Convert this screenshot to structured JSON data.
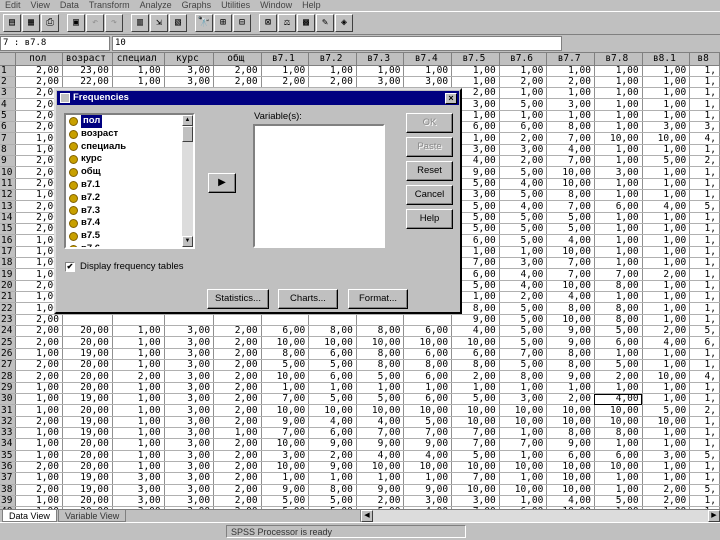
{
  "menu": [
    "Edit",
    "View",
    "Data",
    "Transform",
    "Analyze",
    "Graphs",
    "Utilities",
    "Window",
    "Help"
  ],
  "toolbar": {
    "icons": [
      {
        "name": "open-icon",
        "glyph": "▤"
      },
      {
        "name": "save-icon",
        "glyph": "▦"
      },
      {
        "name": "print-icon",
        "glyph": "⎙"
      },
      {
        "name": "dialog-recall-icon",
        "glyph": "▣"
      },
      {
        "name": "undo-icon",
        "glyph": "↶"
      },
      {
        "name": "redo-icon",
        "glyph": "↷"
      },
      {
        "name": "goto-chart-icon",
        "glyph": "▥"
      },
      {
        "name": "goto-case-icon",
        "glyph": "⇲"
      },
      {
        "name": "variables-icon",
        "glyph": "▧"
      },
      {
        "name": "find-icon",
        "glyph": "🔭"
      },
      {
        "name": "insert-case-icon",
        "glyph": "⊞"
      },
      {
        "name": "insert-variable-icon",
        "glyph": "⊟"
      },
      {
        "name": "split-file-icon",
        "glyph": "⊠"
      },
      {
        "name": "weight-cases-icon",
        "glyph": "⚖"
      },
      {
        "name": "select-cases-icon",
        "glyph": "▩"
      },
      {
        "name": "value-labels-icon",
        "glyph": "✎"
      },
      {
        "name": "use-sets-icon",
        "glyph": "◈"
      }
    ]
  },
  "cellbar": {
    "ref": "7 : в7.8",
    "value": "10"
  },
  "grid": {
    "columns": [
      "пол",
      "возраст",
      "специал",
      "курс",
      "общ",
      "в7.1",
      "в7.2",
      "в7.3",
      "в7.4",
      "в7.5",
      "в7.6",
      "в7.7",
      "в7.8",
      "в8.1",
      "в8"
    ],
    "rows": [
      {
        "n": "1",
        "cells": [
          "2,00",
          "23,00",
          "1,00",
          "3,00",
          "2,00",
          "1,00",
          "1,00",
          "1,00",
          "1,00",
          "1,00",
          "1,00",
          "1,00",
          "1,00",
          "1,00",
          "1,"
        ]
      },
      {
        "n": "2",
        "cells": [
          "2,00",
          "22,00",
          "1,00",
          "3,00",
          "2,00",
          "2,00",
          "2,00",
          "3,00",
          "3,00",
          "1,00",
          "2,00",
          "2,00",
          "1,00",
          "1,00",
          "1,"
        ]
      },
      {
        "n": "3",
        "cells": [
          "2,00",
          "",
          "",
          "",
          "",
          "",
          "",
          "",
          "",
          "2,00",
          "1,00",
          "1,00",
          "1,00",
          "1,00",
          "1,"
        ]
      },
      {
        "n": "4",
        "cells": [
          "2,00",
          "",
          "",
          "",
          "",
          "",
          "",
          "",
          "",
          "3,00",
          "5,00",
          "3,00",
          "1,00",
          "1,00",
          "1,"
        ]
      },
      {
        "n": "5",
        "cells": [
          "2,00",
          "",
          "",
          "",
          "",
          "",
          "",
          "",
          "",
          "1,00",
          "1,00",
          "1,00",
          "1,00",
          "1,00",
          "1,"
        ]
      },
      {
        "n": "6",
        "cells": [
          "2,00",
          "",
          "",
          "",
          "",
          "",
          "",
          "",
          "",
          "6,00",
          "6,00",
          "8,00",
          "1,00",
          "3,00",
          "3,"
        ]
      },
      {
        "n": "7",
        "cells": [
          "1,00",
          "",
          "",
          "",
          "",
          "",
          "",
          "",
          "",
          "1,00",
          "2,00",
          "7,00",
          "10,00",
          "10,00",
          "4,"
        ]
      },
      {
        "n": "8",
        "cells": [
          "1,00",
          "",
          "",
          "",
          "",
          "",
          "",
          "",
          "",
          "3,00",
          "3,00",
          "4,00",
          "1,00",
          "1,00",
          "1,"
        ]
      },
      {
        "n": "9",
        "cells": [
          "2,00",
          "",
          "",
          "",
          "",
          "",
          "",
          "",
          "",
          "4,00",
          "2,00",
          "7,00",
          "1,00",
          "5,00",
          "2,"
        ]
      },
      {
        "n": "10",
        "cells": [
          "2,00",
          "",
          "",
          "",
          "",
          "",
          "",
          "",
          "",
          "9,00",
          "5,00",
          "10,00",
          "3,00",
          "1,00",
          "1,"
        ]
      },
      {
        "n": "11",
        "cells": [
          "2,00",
          "",
          "",
          "",
          "",
          "",
          "",
          "",
          "",
          "5,00",
          "4,00",
          "10,00",
          "1,00",
          "1,00",
          "1,"
        ]
      },
      {
        "n": "12",
        "cells": [
          "1,00",
          "",
          "",
          "",
          "",
          "",
          "",
          "",
          "",
          "3,00",
          "5,00",
          "8,00",
          "1,00",
          "1,00",
          "1,"
        ]
      },
      {
        "n": "13",
        "cells": [
          "2,00",
          "",
          "",
          "",
          "",
          "",
          "",
          "",
          "",
          "5,00",
          "4,00",
          "7,00",
          "6,00",
          "4,00",
          "5,"
        ]
      },
      {
        "n": "14",
        "cells": [
          "2,00",
          "",
          "",
          "",
          "",
          "",
          "",
          "",
          "",
          "5,00",
          "5,00",
          "5,00",
          "1,00",
          "1,00",
          "1,"
        ]
      },
      {
        "n": "15",
        "cells": [
          "2,00",
          "",
          "",
          "",
          "",
          "",
          "",
          "",
          "",
          "5,00",
          "5,00",
          "5,00",
          "1,00",
          "1,00",
          "1,"
        ]
      },
      {
        "n": "16",
        "cells": [
          "1,00",
          "",
          "",
          "",
          "",
          "",
          "",
          "",
          "",
          "6,00",
          "5,00",
          "4,00",
          "1,00",
          "1,00",
          "1,"
        ]
      },
      {
        "n": "17",
        "cells": [
          "1,00",
          "",
          "",
          "",
          "",
          "",
          "",
          "",
          "",
          "1,00",
          "1,00",
          "10,00",
          "1,00",
          "1,00",
          "1,"
        ]
      },
      {
        "n": "18",
        "cells": [
          "1,00",
          "",
          "",
          "",
          "",
          "",
          "",
          "",
          "",
          "7,00",
          "3,00",
          "7,00",
          "1,00",
          "1,00",
          "1,"
        ]
      },
      {
        "n": "19",
        "cells": [
          "1,00",
          "",
          "",
          "",
          "",
          "",
          "",
          "",
          "",
          "6,00",
          "4,00",
          "7,00",
          "7,00",
          "2,00",
          "1,"
        ]
      },
      {
        "n": "20",
        "cells": [
          "2,00",
          "",
          "",
          "",
          "",
          "",
          "",
          "",
          "",
          "5,00",
          "4,00",
          "10,00",
          "8,00",
          "1,00",
          "1,"
        ]
      },
      {
        "n": "21",
        "cells": [
          "1,00",
          "",
          "",
          "",
          "",
          "",
          "",
          "",
          "",
          "1,00",
          "2,00",
          "4,00",
          "1,00",
          "1,00",
          "1,"
        ]
      },
      {
        "n": "22",
        "cells": [
          "1,00",
          "",
          "",
          "",
          "",
          "",
          "",
          "",
          "",
          "8,00",
          "5,00",
          "8,00",
          "8,00",
          "1,00",
          "1,"
        ]
      },
      {
        "n": "23",
        "cells": [
          "2,00",
          "",
          "",
          "",
          "",
          "",
          "",
          "",
          "",
          "9,00",
          "5,00",
          "10,00",
          "8,00",
          "1,00",
          "1,"
        ]
      },
      {
        "n": "24",
        "cells": [
          "2,00",
          "20,00",
          "1,00",
          "3,00",
          "2,00",
          "6,00",
          "8,00",
          "8,00",
          "6,00",
          "4,00",
          "5,00",
          "9,00",
          "5,00",
          "2,00",
          "5,"
        ]
      },
      {
        "n": "25",
        "cells": [
          "2,00",
          "20,00",
          "1,00",
          "3,00",
          "2,00",
          "10,00",
          "10,00",
          "10,00",
          "10,00",
          "10,00",
          "5,00",
          "9,00",
          "6,00",
          "4,00",
          "6,"
        ]
      },
      {
        "n": "26",
        "cells": [
          "1,00",
          "19,00",
          "1,00",
          "3,00",
          "2,00",
          "8,00",
          "6,00",
          "8,00",
          "6,00",
          "6,00",
          "7,00",
          "8,00",
          "1,00",
          "1,00",
          "1,"
        ]
      },
      {
        "n": "27",
        "cells": [
          "2,00",
          "20,00",
          "1,00",
          "3,00",
          "2,00",
          "5,00",
          "5,00",
          "8,00",
          "8,00",
          "8,00",
          "5,00",
          "8,00",
          "5,00",
          "1,00",
          "1,"
        ]
      },
      {
        "n": "28",
        "cells": [
          "2,00",
          "20,00",
          "2,00",
          "3,00",
          "2,00",
          "10,00",
          "6,00",
          "5,00",
          "6,00",
          "2,00",
          "8,00",
          "9,00",
          "2,00",
          "10,00",
          "4,"
        ]
      },
      {
        "n": "29",
        "cells": [
          "1,00",
          "20,00",
          "1,00",
          "3,00",
          "2,00",
          "1,00",
          "1,00",
          "1,00",
          "1,00",
          "1,00",
          "1,00",
          "1,00",
          "1,00",
          "1,00",
          "1,"
        ]
      },
      {
        "n": "30",
        "cells": [
          "1,00",
          "19,00",
          "1,00",
          "3,00",
          "2,00",
          "7,00",
          "5,00",
          "5,00",
          "6,00",
          "5,00",
          "3,00",
          "2,00",
          "4,00",
          "1,00",
          "1,"
        ]
      },
      {
        "n": "31",
        "cells": [
          "1,00",
          "20,00",
          "1,00",
          "3,00",
          "2,00",
          "10,00",
          "10,00",
          "10,00",
          "10,00",
          "10,00",
          "10,00",
          "10,00",
          "10,00",
          "5,00",
          "2,"
        ]
      },
      {
        "n": "32",
        "cells": [
          "2,00",
          "19,00",
          "1,00",
          "3,00",
          "2,00",
          "9,00",
          "4,00",
          "4,00",
          "5,00",
          "10,00",
          "10,00",
          "10,00",
          "10,00",
          "10,00",
          "1,"
        ]
      },
      {
        "n": "33",
        "cells": [
          "1,00",
          "19,00",
          "1,00",
          "3,00",
          "1,00",
          "7,00",
          "6,00",
          "7,00",
          "7,00",
          "7,00",
          "1,00",
          "8,00",
          "8,00",
          "1,00",
          "1,"
        ]
      },
      {
        "n": "34",
        "cells": [
          "1,00",
          "20,00",
          "1,00",
          "3,00",
          "2,00",
          "10,00",
          "9,00",
          "9,00",
          "9,00",
          "7,00",
          "7,00",
          "9,00",
          "1,00",
          "1,00",
          "1,"
        ]
      },
      {
        "n": "35",
        "cells": [
          "1,00",
          "20,00",
          "1,00",
          "3,00",
          "2,00",
          "3,00",
          "2,00",
          "4,00",
          "4,00",
          "5,00",
          "1,00",
          "6,00",
          "6,00",
          "3,00",
          "5,"
        ]
      },
      {
        "n": "36",
        "cells": [
          "2,00",
          "20,00",
          "1,00",
          "3,00",
          "2,00",
          "10,00",
          "9,00",
          "10,00",
          "10,00",
          "10,00",
          "10,00",
          "10,00",
          "10,00",
          "1,00",
          "1,"
        ]
      },
      {
        "n": "37",
        "cells": [
          "1,00",
          "19,00",
          "3,00",
          "3,00",
          "2,00",
          "1,00",
          "1,00",
          "1,00",
          "1,00",
          "7,00",
          "1,00",
          "10,00",
          "1,00",
          "1,00",
          "1,"
        ]
      },
      {
        "n": "38",
        "cells": [
          "2,00",
          "19,00",
          "3,00",
          "3,00",
          "2,00",
          "9,00",
          "8,00",
          "9,00",
          "9,00",
          "10,00",
          "10,00",
          "10,00",
          "1,00",
          "2,00",
          "5,"
        ]
      },
      {
        "n": "39",
        "cells": [
          "1,00",
          "20,00",
          "3,00",
          "3,00",
          "2,00",
          "5,00",
          "5,00",
          "2,00",
          "3,00",
          "3,00",
          "1,00",
          "4,00",
          "5,00",
          "2,00",
          "1,"
        ]
      },
      {
        "n": "40",
        "cells": [
          "1,00",
          "20,00",
          "3,00",
          "3,00",
          "2,00",
          "5,00",
          "5,00",
          "5,00",
          "4,00",
          "7,00",
          "6,00",
          "10,00",
          "1,00",
          "1,00",
          "1,"
        ]
      },
      {
        "n": "41",
        "cells": [
          "1,00",
          "20,00",
          "3,00",
          "3,00",
          "2,00",
          "1,00",
          "1,00",
          "1,00",
          "1,00",
          "1,00",
          "1,00",
          "1,00",
          "1,00",
          "1,00",
          "1,"
        ]
      }
    ]
  },
  "tabs": {
    "data_view": "Data View",
    "variable_view": "Variable View"
  },
  "status": "SPSS Processor is ready",
  "dialog": {
    "title": "Frequencies",
    "variables_label": "Variable(s):",
    "source_variables": [
      "пол",
      "возраст",
      "специаль",
      "курс",
      "общ",
      "в7.1",
      "в7.2",
      "в7.3",
      "в7.4",
      "в7.5",
      "в7.6"
    ],
    "buttons": {
      "ok": "OK",
      "paste": "Paste",
      "reset": "Reset",
      "cancel": "Cancel",
      "help": "Help"
    },
    "display_tables_label": "Display frequency tables",
    "display_tables_checked": true,
    "bottom_buttons": {
      "statistics": "Statistics...",
      "charts": "Charts...",
      "format": "Format..."
    },
    "move_arrow": "▶",
    "close": "×"
  }
}
